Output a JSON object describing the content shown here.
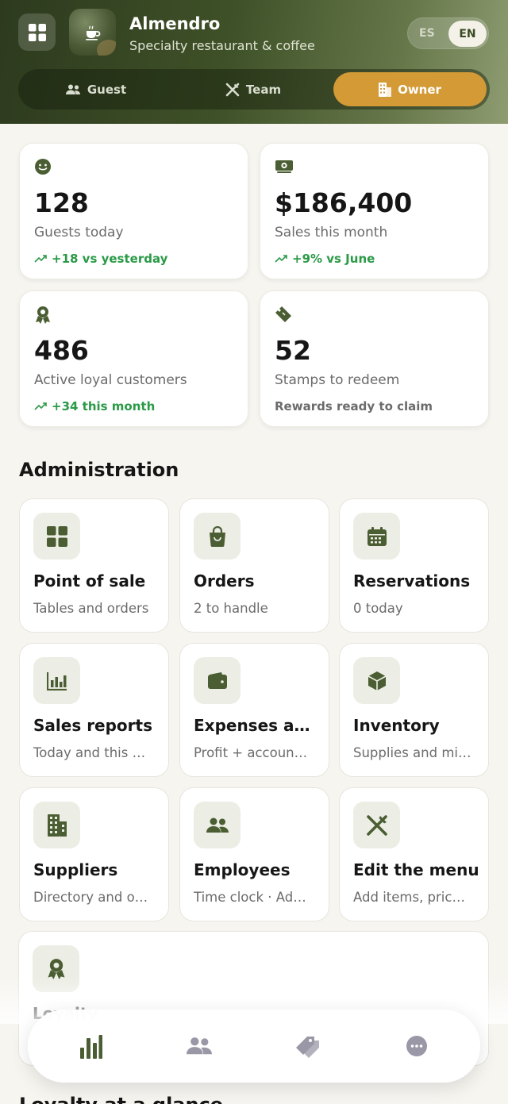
{
  "header": {
    "brand_name": "Almendro",
    "brand_subtitle": "Specialty restaurant & coffee",
    "grid_icon": "grid-icon",
    "logo_icon": "coffee-cup-icon",
    "languages": {
      "es": "ES",
      "en": "EN",
      "selected": "EN"
    },
    "roles": [
      {
        "label": "Guest",
        "icon": "people-icon",
        "active": false
      },
      {
        "label": "Team",
        "icon": "utensils-icon",
        "active": false
      },
      {
        "label": "Owner",
        "icon": "building-icon",
        "active": true
      }
    ]
  },
  "stats": [
    {
      "icon": "smile-icon",
      "value": "128",
      "label": "Guests today",
      "trend": "+18 vs yesterday",
      "trend_positive": true
    },
    {
      "icon": "money-icon",
      "value": "$186,400",
      "label": "Sales this month",
      "trend": "+9% vs June",
      "trend_positive": true
    },
    {
      "icon": "award-icon",
      "value": "486",
      "label": "Active loyal customers",
      "trend": "+34 this month",
      "trend_positive": true
    },
    {
      "icon": "ticket-icon",
      "value": "52",
      "label": "Stamps to redeem",
      "trend": "Rewards ready to claim",
      "trend_positive": false
    }
  ],
  "administration": {
    "title": "Administration",
    "tiles": [
      {
        "icon": "grid-icon",
        "title": "Point of sale",
        "subtitle": "Tables and orders"
      },
      {
        "icon": "bag-icon",
        "title": "Orders",
        "subtitle": "2 to handle"
      },
      {
        "icon": "calendar-icon",
        "title": "Reservations",
        "subtitle": "0 today"
      },
      {
        "icon": "bar-chart-icon",
        "title": "Sales reports",
        "subtitle": "Today and this …"
      },
      {
        "icon": "wallet-icon",
        "title": "Expenses an…",
        "subtitle": "Profit + accoun…"
      },
      {
        "icon": "box-icon",
        "title": "Inventory",
        "subtitle": "Supplies and mi…"
      },
      {
        "icon": "building-icon",
        "title": "Suppliers",
        "subtitle": "Directory and o…"
      },
      {
        "icon": "people-icon",
        "title": "Employees",
        "subtitle": "Time clock · Ad…"
      },
      {
        "icon": "utensils-icon",
        "title": "Edit the menu",
        "subtitle": "Add items, pric…"
      }
    ],
    "wide_tile": {
      "icon": "award-icon",
      "title": "Loyalty"
    }
  },
  "next_section_title": "Loyalty at a glance",
  "bottom_nav": [
    {
      "icon": "bar-chart-icon",
      "active": true
    },
    {
      "icon": "people-icon",
      "active": false
    },
    {
      "icon": "tag-icon",
      "active": false
    },
    {
      "icon": "more-icon",
      "active": false
    }
  ],
  "colors": {
    "accent": "#d39a35",
    "brand_green": "#4b5e33",
    "positive": "#2a9a47"
  }
}
